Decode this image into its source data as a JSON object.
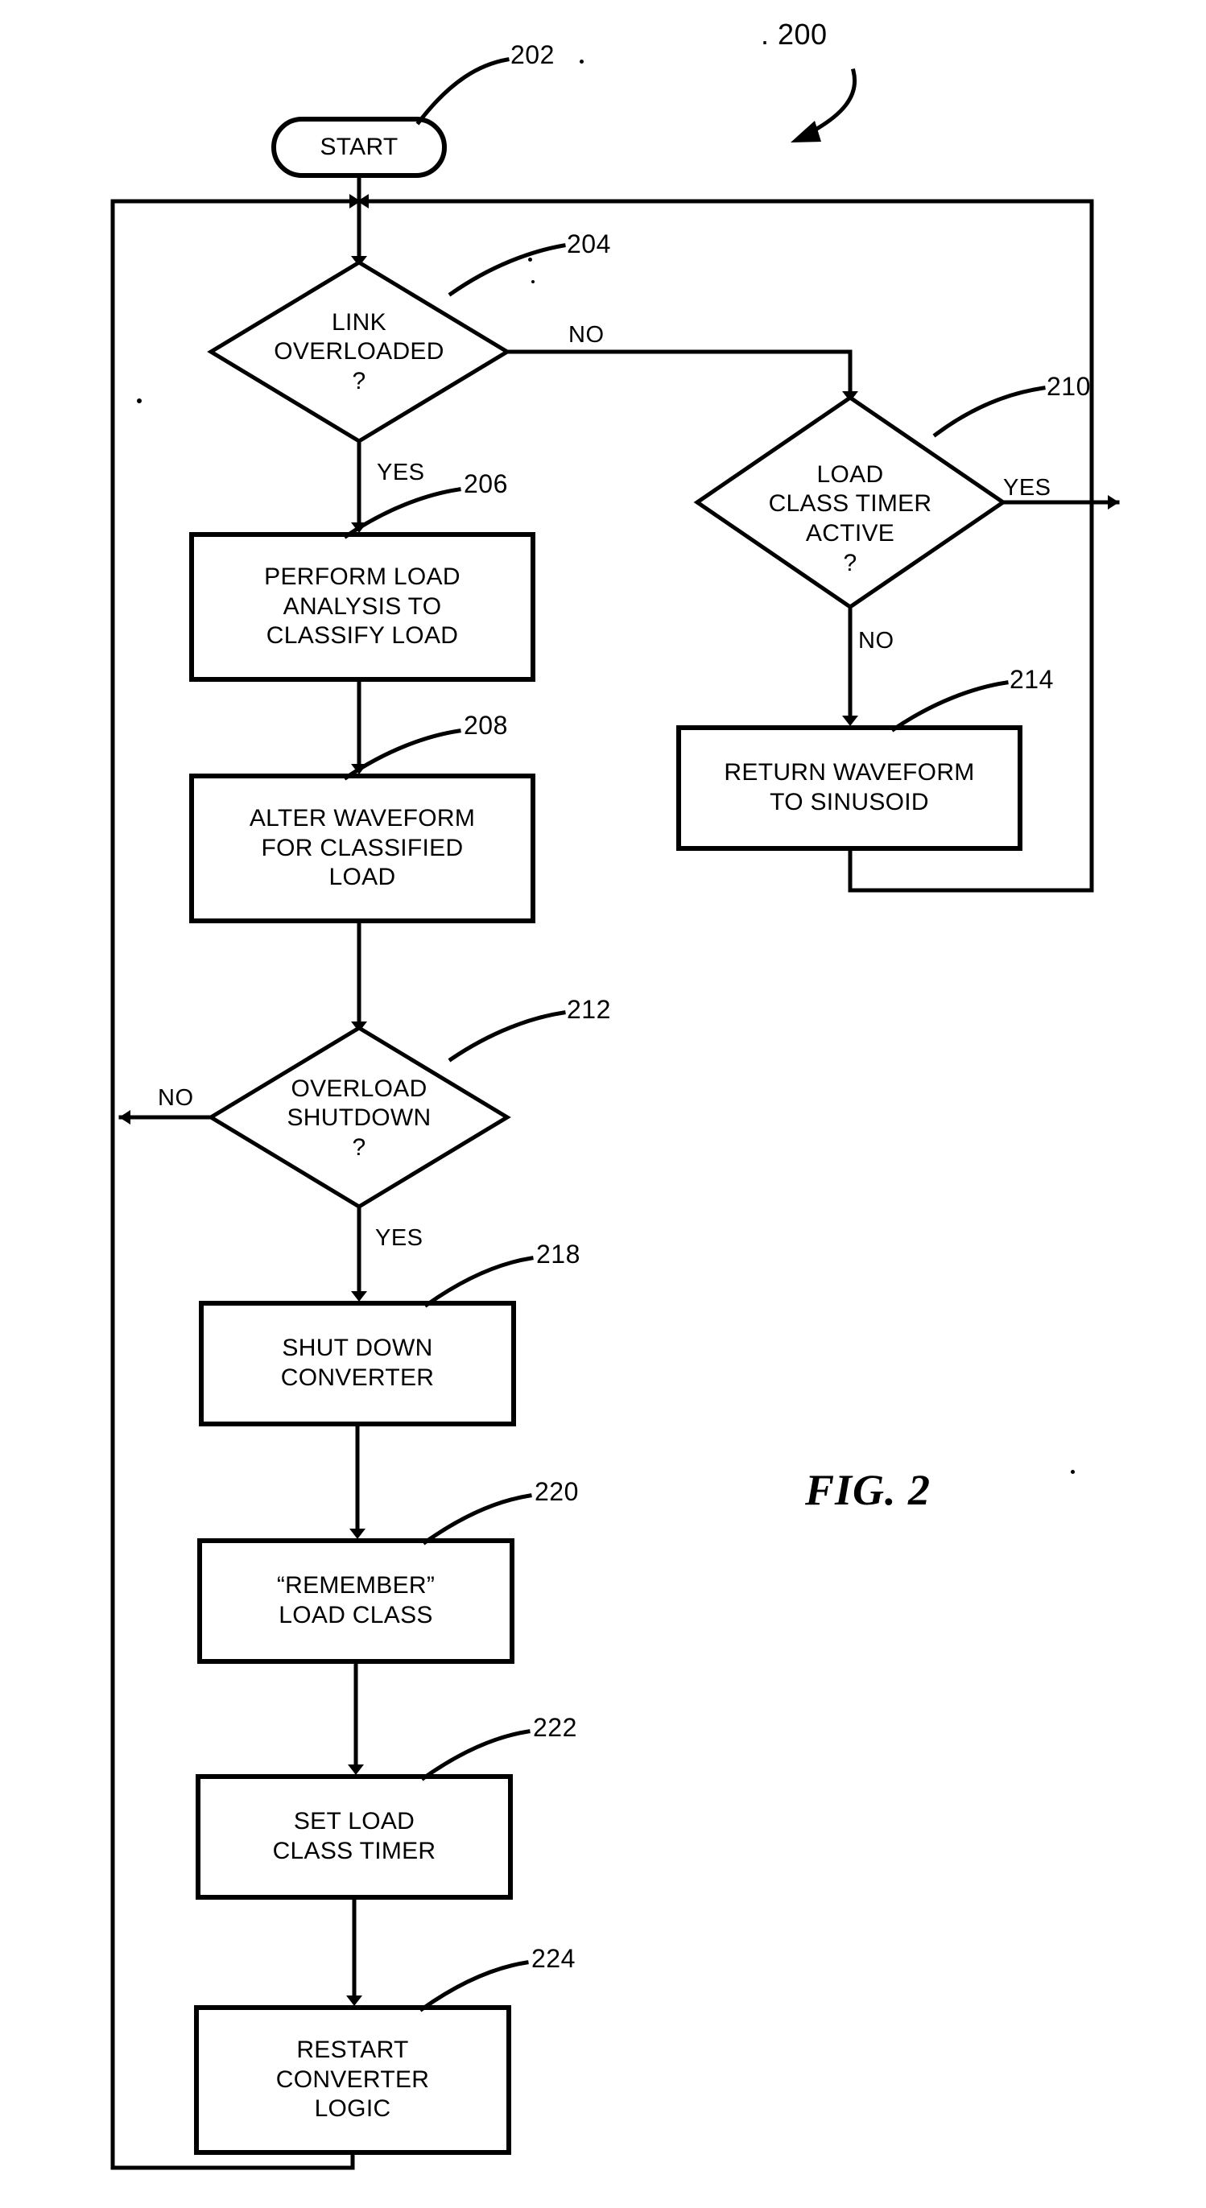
{
  "figure": {
    "label": "FIG. 2",
    "figure_number": ". 200"
  },
  "nodes": [
    {
      "id": "start",
      "ref": "202",
      "shape": "terminator",
      "lines": [
        "START"
      ]
    },
    {
      "id": "link_overloaded",
      "ref": "204",
      "shape": "decision",
      "lines": [
        "LINK",
        "OVERLOADED",
        "?"
      ]
    },
    {
      "id": "perform_load_analysis",
      "ref": "206",
      "shape": "process",
      "lines": [
        "PERFORM LOAD",
        "ANALYSIS TO",
        "CLASSIFY LOAD"
      ]
    },
    {
      "id": "alter_waveform",
      "ref": "208",
      "shape": "process",
      "lines": [
        "ALTER WAVEFORM",
        "FOR CLASSIFIED",
        "LOAD"
      ]
    },
    {
      "id": "load_class_timer_active",
      "ref": "210",
      "shape": "decision",
      "lines": [
        "LOAD",
        "CLASS TIMER",
        "ACTIVE",
        "?"
      ]
    },
    {
      "id": "overload_shutdown",
      "ref": "212",
      "shape": "decision",
      "lines": [
        "OVERLOAD",
        "SHUTDOWN",
        "?"
      ]
    },
    {
      "id": "return_waveform",
      "ref": "214",
      "shape": "process",
      "lines": [
        "RETURN WAVEFORM",
        "TO SINUSOID"
      ]
    },
    {
      "id": "shut_down_converter",
      "ref": "218",
      "shape": "process",
      "lines": [
        "SHUT DOWN",
        "CONVERTER"
      ]
    },
    {
      "id": "remember_load_class",
      "ref": "220",
      "shape": "process",
      "lines": [
        "“REMEMBER”",
        "LOAD CLASS"
      ]
    },
    {
      "id": "set_load_class_timer",
      "ref": "222",
      "shape": "process",
      "lines": [
        "SET LOAD",
        "CLASS TIMER"
      ]
    },
    {
      "id": "restart_converter_logic",
      "ref": "224",
      "shape": "process",
      "lines": [
        "RESTART",
        "CONVERTER",
        "LOGIC"
      ]
    }
  ],
  "edge_labels": {
    "link_overloaded_no": "NO",
    "link_overloaded_yes": "YES",
    "timer_active_yes": "YES",
    "timer_active_no": "NO",
    "overload_shutdown_no": "NO",
    "overload_shutdown_yes": "YES"
  },
  "colors": {
    "stroke": "#000000",
    "background": "#ffffff",
    "text": "#000000"
  }
}
